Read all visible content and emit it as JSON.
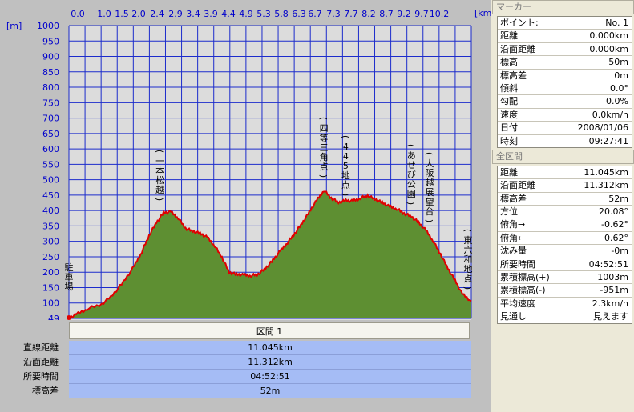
{
  "chart_data": {
    "type": "area",
    "x_unit": "[km]",
    "y_unit": "[m]",
    "x_ticks": [
      "0.0",
      "1.0",
      "1.5",
      "2.0",
      "2.4",
      "2.9",
      "3.4",
      "3.9",
      "4.4",
      "4.9",
      "5.3",
      "5.8",
      "6.3",
      "6.7",
      "7.3",
      "7.7",
      "8.2",
      "8.7",
      "9.2",
      "9.7",
      "10.2"
    ],
    "y_ticks": [
      "1000",
      "950",
      "900",
      "850",
      "800",
      "750",
      "700",
      "650",
      "600",
      "550",
      "500",
      "450",
      "400",
      "350",
      "300",
      "250",
      "200",
      "150",
      "100",
      "49"
    ],
    "ylim": [
      49,
      1000
    ],
    "xlim": [
      0,
      11.045
    ],
    "grid": true,
    "series": [
      {
        "x": [
          0.0,
          0.2,
          0.5,
          0.9,
          1.2,
          1.5,
          1.8,
          2.0,
          2.2,
          2.4,
          2.6,
          2.8,
          3.0,
          3.2,
          3.4,
          3.6,
          3.8,
          4.0,
          4.2,
          4.4,
          4.6,
          4.8,
          5.0,
          5.2,
          5.4,
          5.6,
          5.8,
          6.0,
          6.2,
          6.4,
          6.6,
          6.8,
          7.0,
          7.2,
          7.4,
          7.6,
          7.8,
          8.0,
          8.2,
          8.4,
          8.6,
          8.8,
          9.0,
          9.2,
          9.4,
          9.6,
          9.8,
          10.0,
          10.2,
          10.4,
          10.6,
          10.8,
          11.045
        ],
        "y": [
          50,
          62,
          80,
          95,
          125,
          168,
          220,
          265,
          318,
          360,
          392,
          395,
          375,
          342,
          332,
          325,
          312,
          285,
          248,
          198,
          192,
          190,
          188,
          193,
          212,
          238,
          268,
          295,
          325,
          358,
          395,
          432,
          465,
          440,
          425,
          432,
          430,
          440,
          448,
          436,
          425,
          412,
          405,
          390,
          380,
          360,
          335,
          300,
          258,
          212,
          172,
          128,
          105
        ]
      }
    ],
    "annotations": [
      {
        "text": "駐車場",
        "x": 0.0
      },
      {
        "text": "(一本松越)",
        "x": 2.5
      },
      {
        "text": "(四等三角点)",
        "x": 7.0
      },
      {
        "text": "(445地点)",
        "x": 7.6
      },
      {
        "text": "(あせび公園)",
        "x": 9.4
      },
      {
        "text": "(大阪越展望台)",
        "x": 9.9
      },
      {
        "text": "(東六和地点)",
        "x": 11.0
      }
    ],
    "colors": {
      "fill": "#5e8f32",
      "line": "#e00000",
      "plot_bg": "#dcdcdc",
      "grid": "#1c2ccc",
      "ticks": "#0000cc"
    }
  },
  "section_header": "区間 1",
  "summary": [
    {
      "label": "直線距離",
      "value": "11.045km"
    },
    {
      "label": "沿面距離",
      "value": "11.312km"
    },
    {
      "label": "所要時間",
      "value": "04:52:51"
    },
    {
      "label": "標高差",
      "value": "52m"
    }
  ],
  "marker_panel": {
    "title": "マーカー",
    "rows": [
      {
        "key": "ポイント:",
        "value": "No. 1"
      },
      {
        "key": "距離",
        "value": "0.000km"
      },
      {
        "key": "沿面距離",
        "value": "0.000km"
      },
      {
        "key": "標高",
        "value": "50m"
      },
      {
        "key": "標高差",
        "value": "0m"
      },
      {
        "key": "傾斜",
        "value": "0.0°"
      },
      {
        "key": "勾配",
        "value": "0.0%"
      },
      {
        "key": "速度",
        "value": "0.0km/h"
      },
      {
        "key": "日付",
        "value": "2008/01/06"
      },
      {
        "key": "時刻",
        "value": "09:27:41"
      }
    ]
  },
  "section_panel": {
    "title": "全区間",
    "rows": [
      {
        "key": "距離",
        "value": "11.045km"
      },
      {
        "key": "沿面距離",
        "value": "11.312km"
      },
      {
        "key": "標高差",
        "value": "52m"
      },
      {
        "key": "方位",
        "value": "20.08°"
      },
      {
        "key": "俯角→",
        "value": "-0.62°"
      },
      {
        "key": "俯角←",
        "value": "0.62°"
      },
      {
        "key": "沈み量",
        "value": "-0m"
      },
      {
        "key": "所要時間",
        "value": "04:52:51"
      },
      {
        "key": "累積標高(+)",
        "value": "1003m"
      },
      {
        "key": "累積標高(-)",
        "value": "-951m"
      },
      {
        "key": "平均速度",
        "value": "2.3km/h"
      },
      {
        "key": "見通し",
        "value": "見えます"
      }
    ]
  }
}
